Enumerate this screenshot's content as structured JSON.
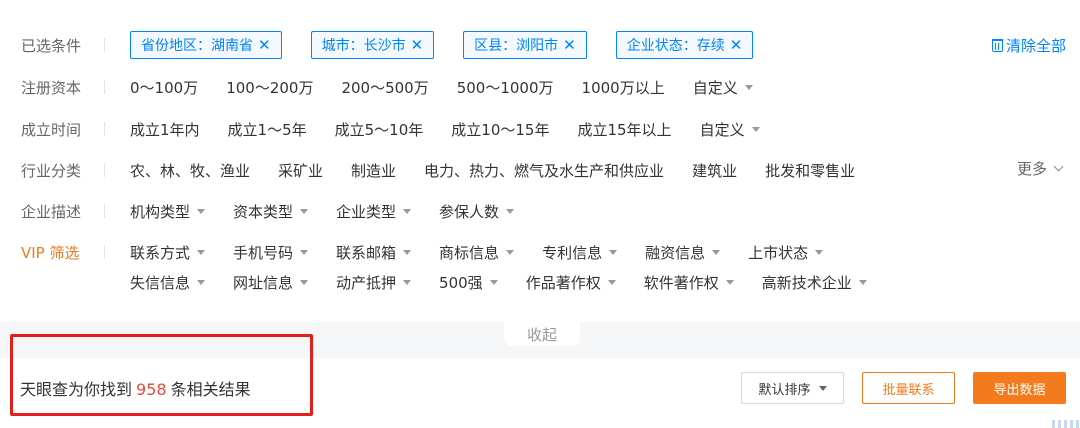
{
  "selected": {
    "label": "已选条件",
    "tags": [
      {
        "text": "省份地区：湖南省"
      },
      {
        "text": "城市：长沙市"
      },
      {
        "text": "区县：浏阳市"
      },
      {
        "text": "企业状态：存续"
      }
    ],
    "clear_all": "清除全部"
  },
  "capital": {
    "label": "注册资本",
    "options": [
      "0～100万",
      "100～200万",
      "200～500万",
      "500～1000万",
      "1000万以上"
    ],
    "custom": "自定义"
  },
  "founded": {
    "label": "成立时间",
    "options": [
      "成立1年内",
      "成立1～5年",
      "成立5～10年",
      "成立10～15年",
      "成立15年以上"
    ],
    "custom": "自定义"
  },
  "industry": {
    "label": "行业分类",
    "options": [
      "农、林、牧、渔业",
      "采矿业",
      "制造业",
      "电力、热力、燃气及水生产和供应业",
      "建筑业",
      "批发和零售业"
    ],
    "more": "更多"
  },
  "description": {
    "label": "企业描述",
    "options": [
      "机构类型",
      "资本类型",
      "企业类型",
      "参保人数"
    ]
  },
  "vip": {
    "label": "VIP 筛选",
    "row1": [
      "联系方式",
      "手机号码",
      "联系邮箱",
      "商标信息",
      "专利信息",
      "融资信息",
      "上市状态"
    ],
    "row2": [
      "失信信息",
      "网址信息",
      "动产抵押",
      "500强",
      "作品著作权",
      "软件著作权",
      "高新技术企业"
    ]
  },
  "collapse": "收起",
  "results": {
    "prefix": "天眼查为你找到",
    "count": "958",
    "suffix": "条相关结果"
  },
  "actions": {
    "sort": "默认排序",
    "batch": "批量联系",
    "export": "导出数据"
  },
  "colors": {
    "accent_blue": "#0084ff",
    "accent_orange": "#f37b1d",
    "count_red": "#e84a3b",
    "highlight_red": "#e0201c"
  }
}
